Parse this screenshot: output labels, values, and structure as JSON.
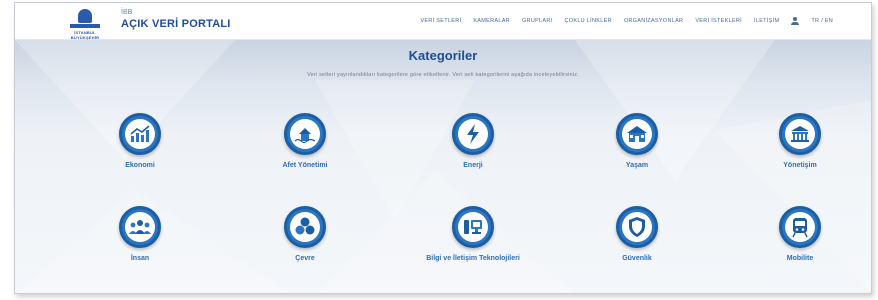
{
  "header": {
    "logo_text": "İSTANBUL BÜYÜKŞEHİR",
    "brand_small": "İBB",
    "brand_title": "AÇIK VERİ PORTALI",
    "nav": [
      "VERİ SETLERİ",
      "KAMERALAR",
      "GRUPLARI",
      "ÇOKLU LİNKLER",
      "ORGANİZASYONLAR",
      "VERİ İSTEKLERİ",
      "İLETİŞİM"
    ],
    "lang": "TR  /  EN"
  },
  "page": {
    "title": "Kategoriler",
    "subtitle": "Veri setleri yayınlandıkları kategorilere göre etiketlenir. Veri seti kategorilerini aşağıda inceleyebilirsiniz."
  },
  "categories": [
    {
      "label": "Ekonomi",
      "icon": "chart-icon"
    },
    {
      "label": "Afet Yönetimi",
      "icon": "disaster-icon"
    },
    {
      "label": "Enerji",
      "icon": "lightning-icon"
    },
    {
      "label": "Yaşam",
      "icon": "house-icon"
    },
    {
      "label": "Yönetişim",
      "icon": "building-icon"
    },
    {
      "label": "İnsan",
      "icon": "people-icon"
    },
    {
      "label": "Çevre",
      "icon": "recycle-icon"
    },
    {
      "label": "Bilgi ve İletişim Teknolojileri",
      "icon": "computer-icon"
    },
    {
      "label": "Güvenlik",
      "icon": "shield-icon"
    },
    {
      "label": "Mobilite",
      "icon": "train-icon"
    }
  ],
  "colors": {
    "accent": "#2a76c0",
    "title": "#1d4f95"
  }
}
